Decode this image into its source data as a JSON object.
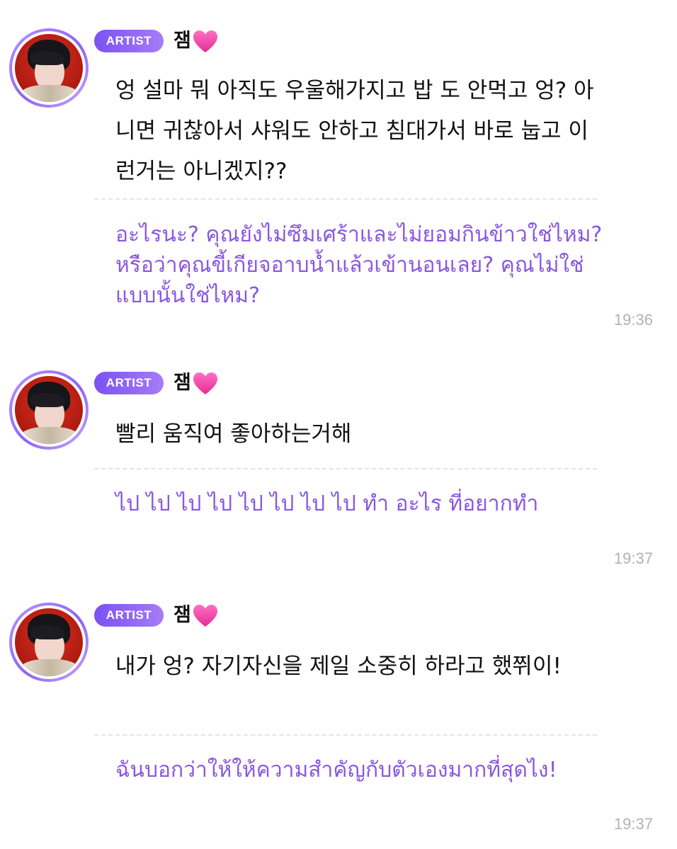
{
  "messages": [
    {
      "badge": "ARTIST",
      "author": "잼",
      "korean": "엉 설마 뭐 아직도 우울해가지고 밥 도 안먹고 엉? 아니면 귀찮아서 샤워도 안하고 침대가서 바로 눕고 이런거는 아니겠지??",
      "translation": "อะไรนะ? คุณยังไม่ซึมเศร้าและไม่ยอมกินข้าวใช่ไหม? หรือว่าคุณขี้เกียจอาบน้ำแล้วเข้านอนเลย? คุณไม่ใช่แบบนั้นใช่ไหม?",
      "time": "19:36"
    },
    {
      "badge": "ARTIST",
      "author": "잼",
      "korean": "빨리 움직여 좋아하는거해",
      "translation": "ไป ไป ไป ไป ไป ไป ไป ไป ทำ อะไร ที่อยากทำ",
      "time": "19:37"
    },
    {
      "badge": "ARTIST",
      "author": "잼",
      "korean": "내가 엉? 자기자신을 제일 소중히 하라고 했쮜이!",
      "translation": "ฉันบอกว่าให้ให้ความสำคัญกับตัวเองมากที่สุดไง!",
      "time": "19:37"
    }
  ],
  "colors": {
    "badge_start": "#7b52f2",
    "badge_end": "#a57cf7",
    "translation_text": "#8a57e0",
    "heart": "#f03ea5",
    "timestamp": "#b2b2b2"
  },
  "icons": {
    "heart": "pink-heart-icon"
  }
}
